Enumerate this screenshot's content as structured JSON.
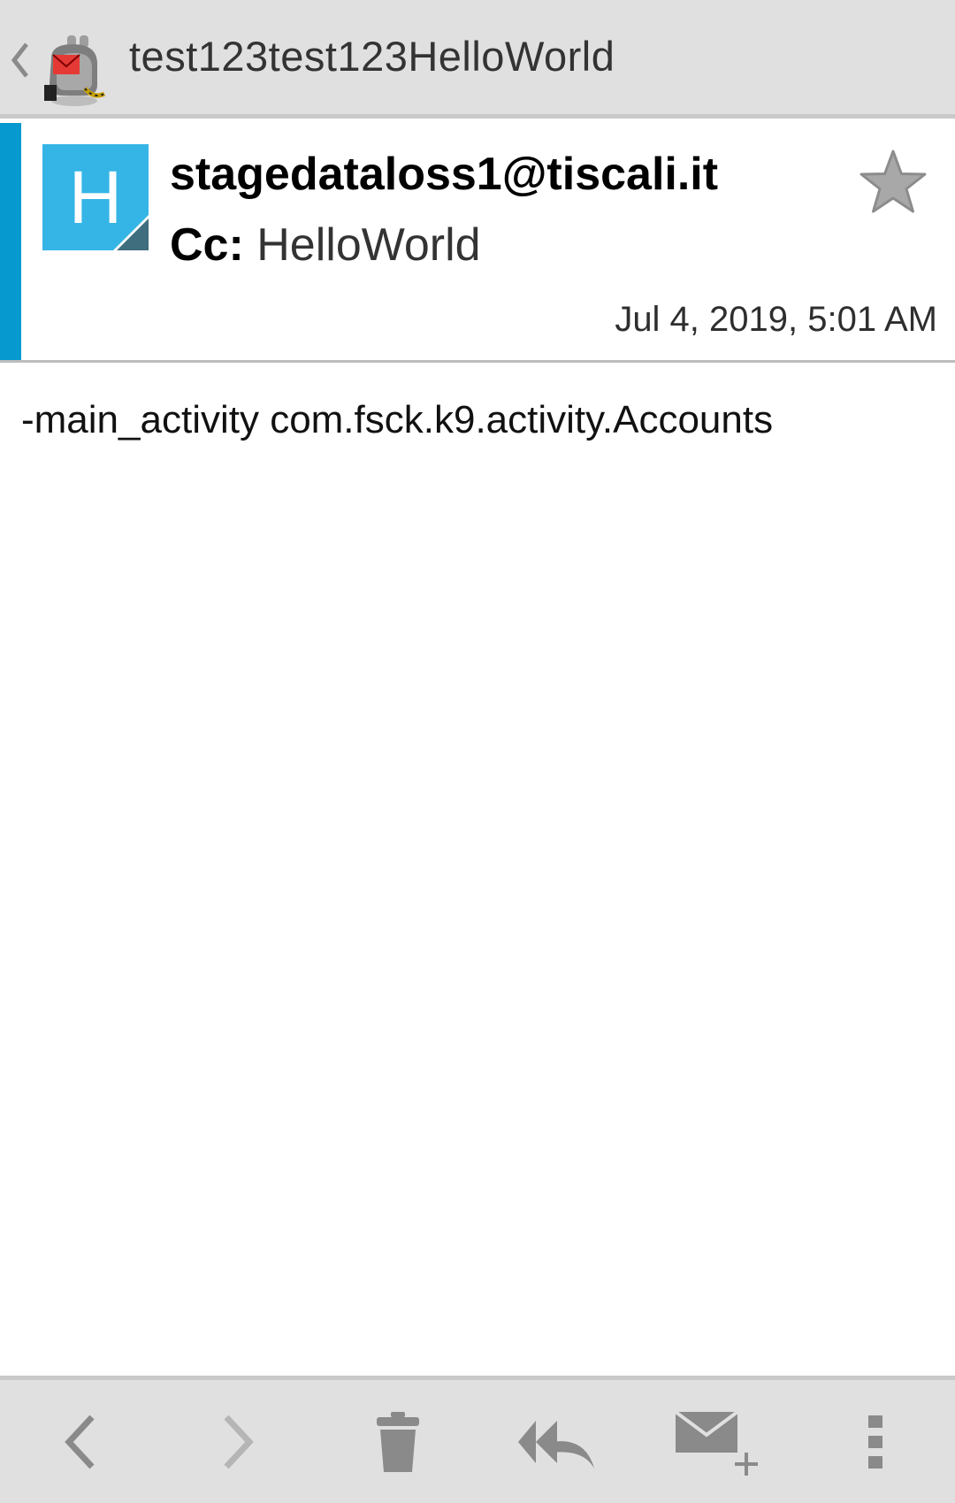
{
  "action_bar": {
    "title": "test123test123HelloWorld",
    "up_icon": "chevron-left-icon",
    "logo_icon": "k9-mail-dog-icon"
  },
  "message": {
    "avatar_letter": "H",
    "from": "stagedataloss1@tiscali.it",
    "cc_label": "Cc:",
    "cc_value": "HelloWorld",
    "date": "Jul 4, 2019, 5:01 AM",
    "starred": false,
    "body": "-main_activity com.fsck.k9.activity.Accounts"
  },
  "bottom_bar": {
    "buttons": [
      {
        "icon": "previous-icon"
      },
      {
        "icon": "next-icon"
      },
      {
        "icon": "delete-icon"
      },
      {
        "icon": "reply-all-icon"
      },
      {
        "icon": "compose-icon"
      },
      {
        "icon": "overflow-menu-icon"
      }
    ]
  },
  "colors": {
    "accent": "#0599cf",
    "avatar": "#35b5e5",
    "bar": "#e0e0e0",
    "icon": "#8a8a8a"
  }
}
